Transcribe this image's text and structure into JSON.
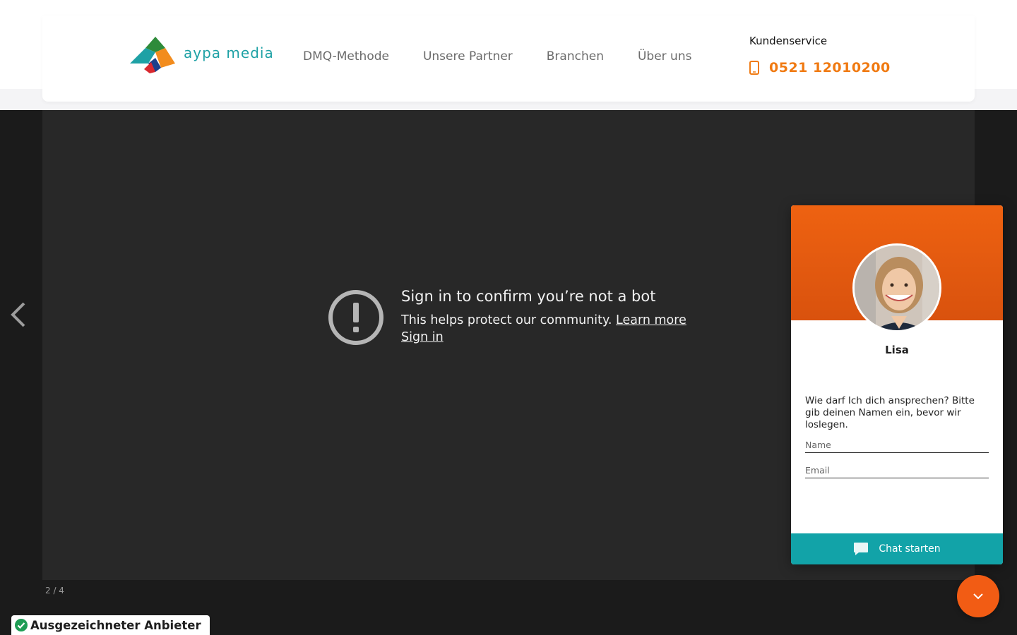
{
  "brand": {
    "logo_text": "aypa media"
  },
  "nav": {
    "items": [
      {
        "label": "DMQ-Methode"
      },
      {
        "label": "Unsere Partner"
      },
      {
        "label": "Branchen"
      },
      {
        "label": "Über uns"
      }
    ]
  },
  "contact": {
    "label": "Kundenservice",
    "phone": "0521 12010200",
    "icon": "phone-icon",
    "accent_color": "#f07a12"
  },
  "video": {
    "title": "Sign in to confirm you’re not a bot",
    "description": "This helps protect our community.",
    "learn_more": "Learn more",
    "sign_in": "Sign in",
    "slide_counter": "2 / 4"
  },
  "badge": {
    "label": "Ausgezeichneter Anbieter",
    "icon": "check-circle-icon"
  },
  "chat": {
    "agent_name": "Lisa",
    "message": "Wie darf Ich dich ansprechen? Bitte gib deinen Namen ein, bevor wir loslegen.",
    "name_placeholder": "Name",
    "email_placeholder": "Email",
    "start_label": "Chat starten",
    "header_color": "#ee6211",
    "button_color": "#12a3a8"
  }
}
